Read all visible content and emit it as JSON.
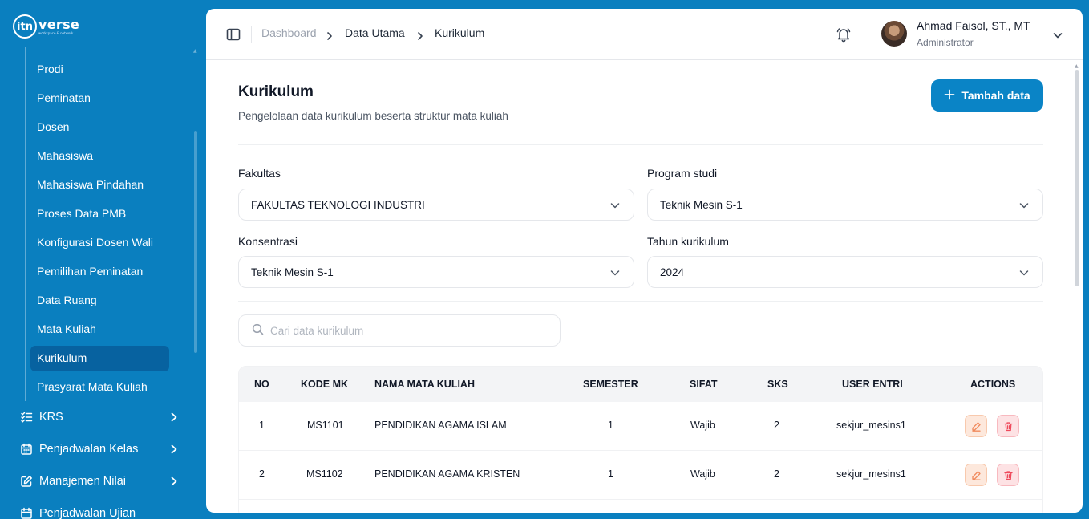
{
  "brand": {
    "mark": "itn",
    "word": "verse",
    "tagline": "workspace & network"
  },
  "sidebar": {
    "sub_items": [
      {
        "label": "Prodi"
      },
      {
        "label": "Peminatan"
      },
      {
        "label": "Dosen"
      },
      {
        "label": "Mahasiswa"
      },
      {
        "label": "Mahasiswa Pindahan"
      },
      {
        "label": "Proses Data PMB"
      },
      {
        "label": "Konfigurasi Dosen Wali"
      },
      {
        "label": "Pemilihan Peminatan"
      },
      {
        "label": "Data Ruang"
      },
      {
        "label": "Mata Kuliah"
      },
      {
        "label": "Kurikulum",
        "active": true
      },
      {
        "label": "Prasyarat Mata Kuliah"
      }
    ],
    "menu_items": [
      {
        "label": "KRS",
        "icon": "checklist-icon"
      },
      {
        "label": "Penjadwalan Kelas",
        "icon": "calendar-icon"
      },
      {
        "label": "Manajemen Nilai",
        "icon": "edit-square-icon"
      },
      {
        "label": "Penjadwalan Ujian",
        "icon": "calendar-icon"
      }
    ]
  },
  "header": {
    "breadcrumb": [
      "Dashboard",
      "Data Utama",
      "Kurikulum"
    ],
    "user": {
      "name": "Ahmad Faisol, ST., MT",
      "role": "Administrator"
    }
  },
  "page": {
    "title": "Kurikulum",
    "subtitle": "Pengelolaan data kurikulum beserta struktur mata kuliah",
    "add_button": "Tambah data"
  },
  "filters": {
    "fakultas": {
      "label": "Fakultas",
      "value": "FAKULTAS TEKNOLOGI INDUSTRI"
    },
    "prodi": {
      "label": "Program studi",
      "value": "Teknik Mesin S-1"
    },
    "konsentrasi": {
      "label": "Konsentrasi",
      "value": "Teknik Mesin S-1"
    },
    "tahun": {
      "label": "Tahun kurikulum",
      "value": "2024"
    }
  },
  "search": {
    "placeholder": "Cari data kurikulum"
  },
  "table": {
    "headers": [
      "NO",
      "KODE MK",
      "NAMA MATA KULIAH",
      "SEMESTER",
      "SIFAT",
      "SKS",
      "USER ENTRI",
      "ACTIONS"
    ],
    "rows": [
      {
        "no": "1",
        "kode": "MS1101",
        "nama": "PENDIDIKAN AGAMA ISLAM",
        "semester": "1",
        "sifat": "Wajib",
        "sks": "2",
        "user": "sekjur_mesins1"
      },
      {
        "no": "2",
        "kode": "MS1102",
        "nama": "PENDIDIKAN AGAMA KRISTEN",
        "semester": "1",
        "sifat": "Wajib",
        "sks": "2",
        "user": "sekjur_mesins1"
      }
    ]
  },
  "colors": {
    "brand": "#0a7fbf",
    "active_bg": "#0762a0",
    "button": "#0a84c6",
    "edit": "#f08a5d",
    "delete": "#ef4a5c"
  }
}
